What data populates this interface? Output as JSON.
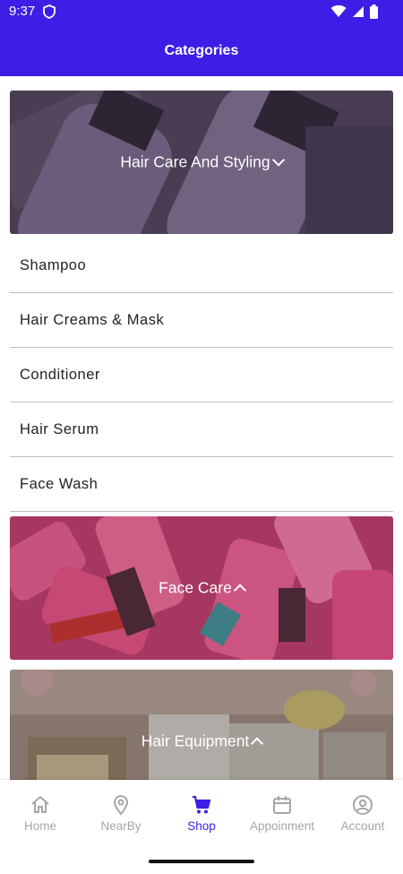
{
  "status": {
    "time": "9:37"
  },
  "appbar": {
    "title": "Categories"
  },
  "categories": [
    {
      "label": "Hair Care And Styling",
      "expanded": true,
      "items": [
        "Shampoo",
        "Hair Creams & Mask",
        "Conditioner",
        "Hair Serum",
        "Face Wash"
      ]
    },
    {
      "label": "Face Care",
      "expanded": false
    },
    {
      "label": "Hair Equipment",
      "expanded": false
    }
  ],
  "nav": [
    {
      "label": "Home",
      "icon": "home-icon",
      "active": false
    },
    {
      "label": "NearBy",
      "icon": "location-pin-icon",
      "active": false
    },
    {
      "label": "Shop",
      "icon": "cart-icon",
      "active": true
    },
    {
      "label": "Appoinment",
      "icon": "calendar-icon",
      "active": false
    },
    {
      "label": "Account",
      "icon": "account-icon",
      "active": false
    }
  ],
  "colors": {
    "primary": "#3d1ee6",
    "inactive": "#a6a6a6"
  }
}
